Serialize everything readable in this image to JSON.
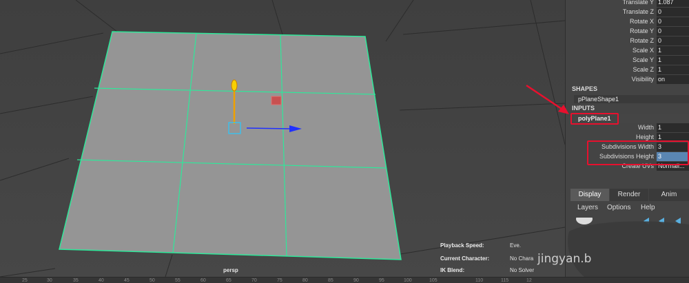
{
  "channel_box": {
    "transform_attrs": [
      {
        "label": "Translate Y",
        "value": "1.087"
      },
      {
        "label": "Translate Z",
        "value": "0"
      },
      {
        "label": "Rotate X",
        "value": "0"
      },
      {
        "label": "Rotate Y",
        "value": "0"
      },
      {
        "label": "Rotate Z",
        "value": "0"
      },
      {
        "label": "Scale X",
        "value": "1"
      },
      {
        "label": "Scale Y",
        "value": "1"
      },
      {
        "label": "Scale Z",
        "value": "1"
      },
      {
        "label": "Visibility",
        "value": "on"
      }
    ],
    "shapes_header": "SHAPES",
    "shape_node": "pPlaneShape1",
    "inputs_header": "INPUTS",
    "input_node": "polyPlane1",
    "input_attrs": [
      {
        "label": "Width",
        "value": "1"
      },
      {
        "label": "Height",
        "value": "1"
      },
      {
        "label": "Subdivisions Width",
        "value": "3"
      },
      {
        "label": "Subdivisions Height",
        "value": "3"
      },
      {
        "label": "Create UVs",
        "value": "Normali..."
      }
    ]
  },
  "tabs": [
    "Display",
    "Render",
    "Anim"
  ],
  "layer_menu": [
    "Layers",
    "Options",
    "Help"
  ],
  "viewport": {
    "camera": "persp",
    "hud": [
      {
        "label": "Playback Speed:",
        "value": "Eve."
      },
      {
        "label": "Current Character:",
        "value": "No Chara"
      },
      {
        "label": "IK Blend:",
        "value": "No Solver"
      }
    ],
    "watermark": "jingyan.b"
  },
  "timeline_ticks": [
    "25",
    "30",
    "35",
    "40",
    "45",
    "50",
    "55",
    "60",
    "65",
    "70",
    "75",
    "80",
    "85",
    "90",
    "95",
    "100",
    "105",
    "110",
    "115",
    "12"
  ],
  "colors": {
    "highlight_red": "#e8102e",
    "plane_edge": "#2ee89a",
    "selected_field": "#5a86b3"
  }
}
